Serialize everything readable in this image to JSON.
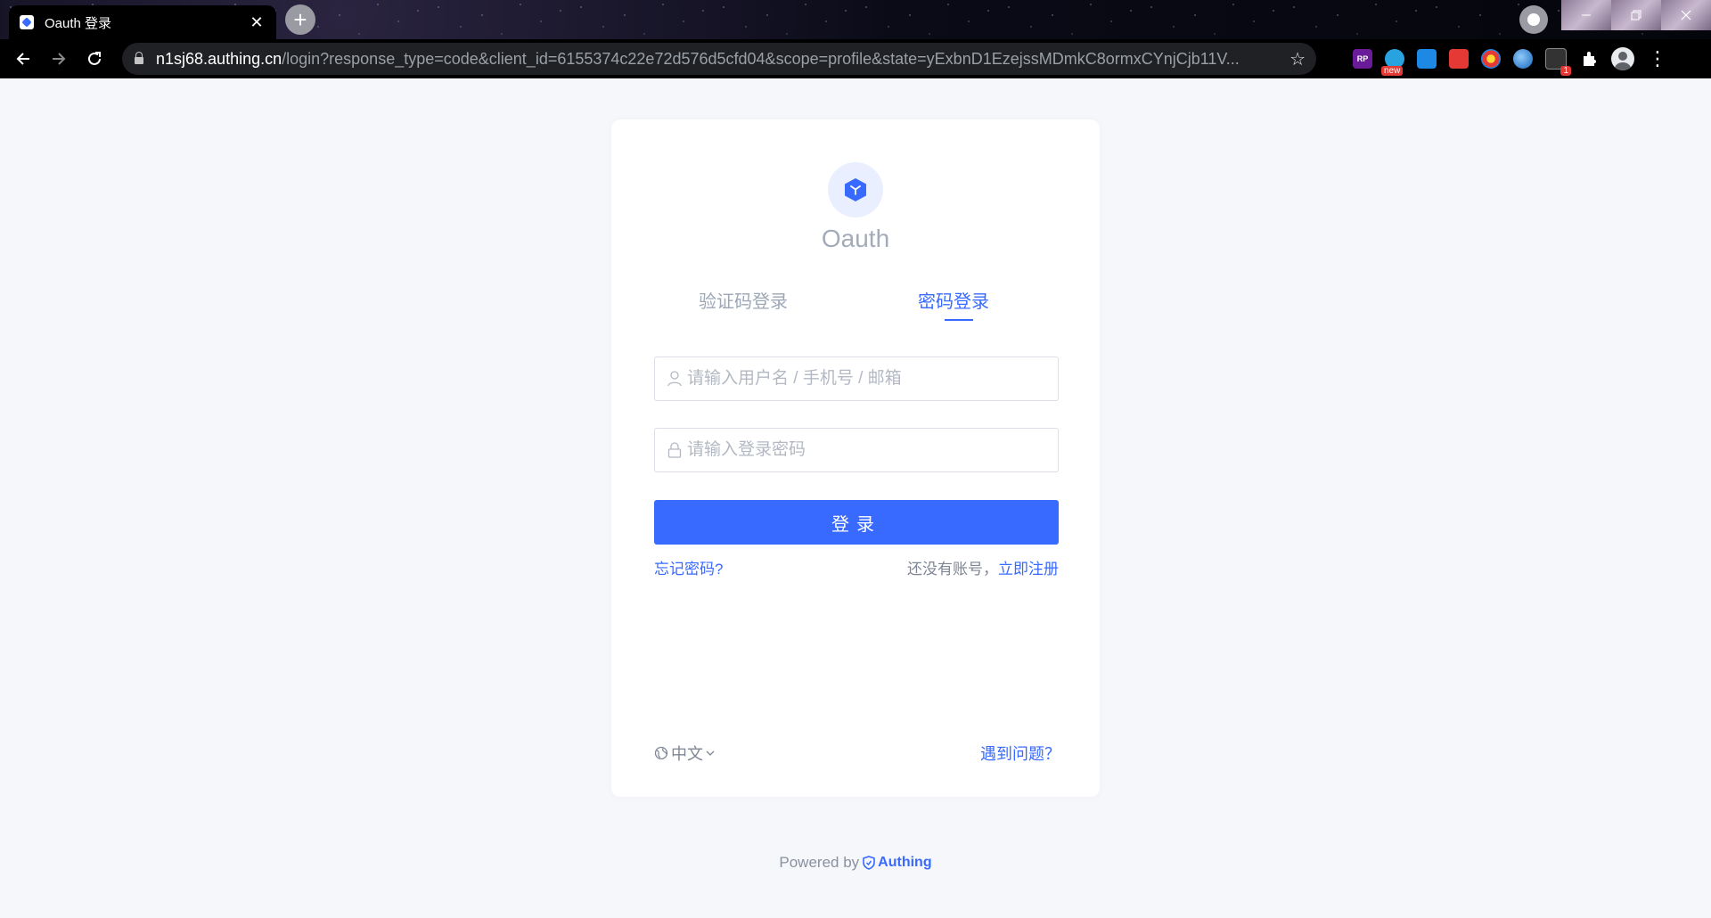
{
  "browser": {
    "tab_title": "Oauth 登录",
    "close_glyph": "✕",
    "new_tab_glyph": "+",
    "url_host": "n1sj68.authing.cn",
    "url_rest": "/login?response_type=code&client_id=6155374c22e72d576d5cfd04&scope=profile&state=yExbnD1EzejssMDmkC8ormxCYnjCjb11V...",
    "star_glyph": "☆",
    "ext_new_badge": "new",
    "ext_count_badge": "1"
  },
  "app": {
    "name": "Oauth",
    "accent_color": "#396aff"
  },
  "login": {
    "tabs": [
      {
        "label": "验证码登录",
        "active": false
      },
      {
        "label": "密码登录",
        "active": true
      }
    ],
    "username_placeholder": "请输入用户名 / 手机号 / 邮箱",
    "password_placeholder": "请输入登录密码",
    "submit_label": "登录",
    "forgot_label": "忘记密码?",
    "no_account_label": "还没有账号，",
    "signup_label": "立即注册"
  },
  "footer": {
    "language": "中文",
    "help_label": "遇到问题？",
    "powered_by": "Powered by",
    "brand": "Authing"
  }
}
